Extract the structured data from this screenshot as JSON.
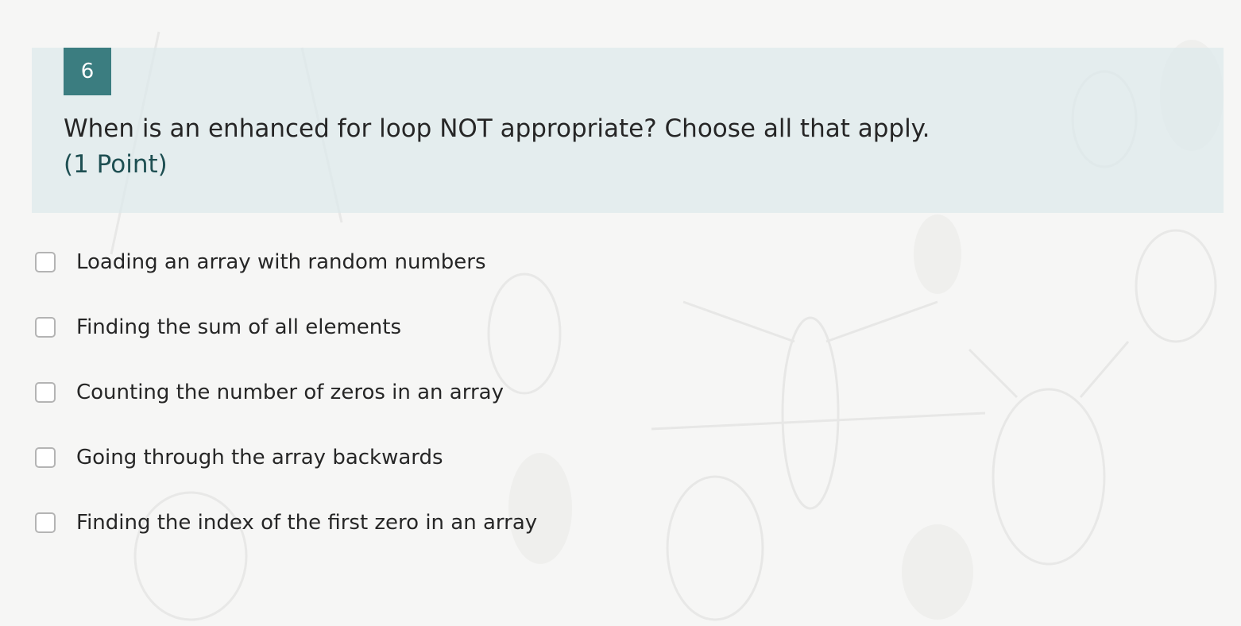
{
  "question": {
    "number": "6",
    "title": "When is an enhanced for loop NOT appropriate? Choose all that apply.",
    "points": "(1 Point)"
  },
  "options": [
    {
      "label": "Loading an array with random numbers",
      "checked": false
    },
    {
      "label": "Finding the sum of all elements",
      "checked": false
    },
    {
      "label": "Counting the number of zeros in an array",
      "checked": false
    },
    {
      "label": "Going through the array backwards",
      "checked": false
    },
    {
      "label": "Finding the index of the first zero in an array",
      "checked": false
    }
  ],
  "colors": {
    "accent": "#3b7d80",
    "header_background": "#dde9ec",
    "points_text": "#1e4f52",
    "page_background": "#f6f6f5"
  },
  "icons": {
    "background": "faded-insect-illustration"
  }
}
